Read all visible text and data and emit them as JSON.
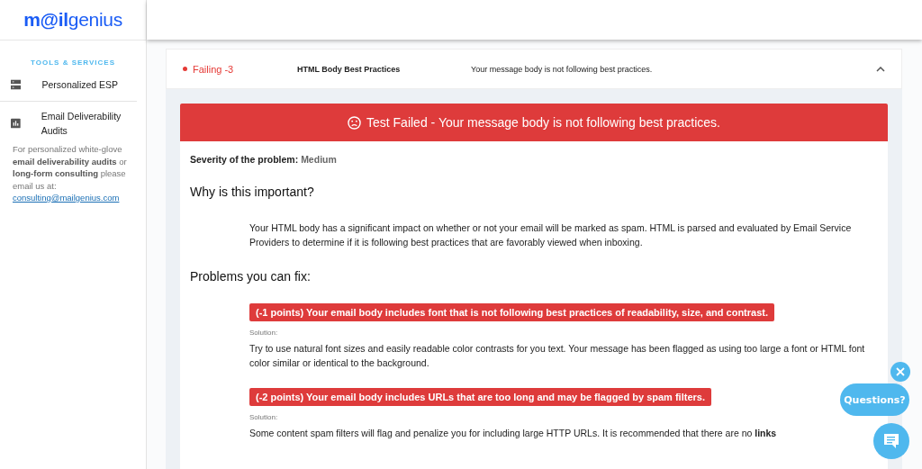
{
  "logo": "**m@il**genius",
  "sidebar": {
    "section_title": "TOOLS & SERVICES",
    "items": [
      {
        "label": "Personalized ESP",
        "kind": "server"
      },
      {
        "label": "Email Deliverability Audits",
        "kind": "chart"
      }
    ],
    "note": "For personalized white-glove **email deliverability audits** or **long-form consulting** please email us at:",
    "email_link": "consulting@mailgenius.com"
  },
  "test": {
    "status": "Failing -3",
    "passing": false,
    "name": "HTML Body Best Practices",
    "summary": "Your message body is not following best practices.",
    "expanded": true,
    "banner": "Test Failed - Your message body is not following best practices.",
    "severity_label": "Severity of the problem:",
    "severity": "Medium",
    "why_title": "Why is this important?",
    "why_text": "Your HTML body has a significant impact on whether or not your email will be marked as spam. HTML is parsed and evaluated by Email Service Providers to determine if it is following best practices that are favorably viewed when inboxing.",
    "problems_title": "Problems you can fix:",
    "problems": [
      {
        "title": "(-1 points) Your email body includes font that is not following best practices of readability, size, and contrast.",
        "solution_label": "Solution:",
        "solution": "Try to use natural font sizes and easily readable color contrasts for you text. Your message has been flagged as using too large a font or HTML font color similar or identical to the background."
      },
      {
        "title": "(-2 points) Your email body includes URLs that are too long and may be flagged by spam filters.",
        "solution_label": "Solution:",
        "solution": "Some content spam filters will flag and penalize you for including large HTTP URLs. It is recommended that there are no **links**"
      }
    ]
  },
  "chat": {
    "label": "Questions?"
  }
}
